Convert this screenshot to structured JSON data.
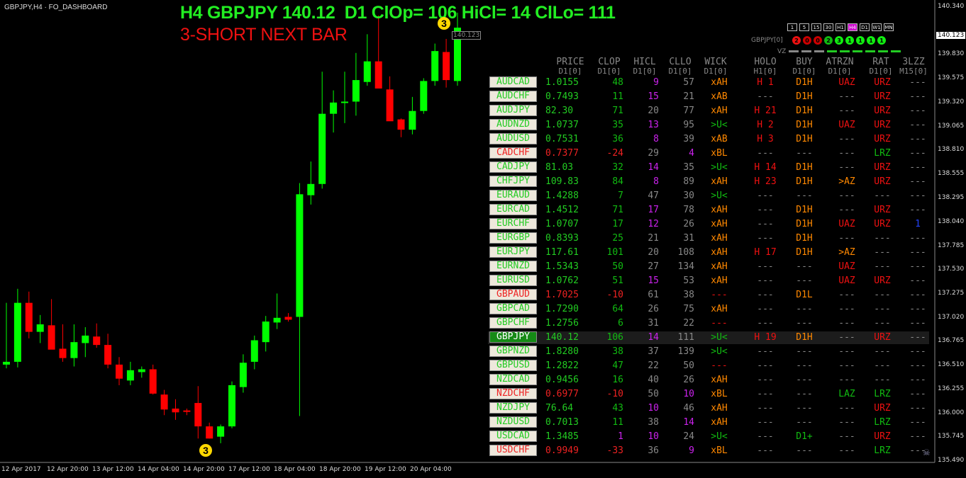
{
  "window": {
    "title": "GBPJPY,H4 · FO_DASHBOARD",
    "indicator_name": "FO_DASHBOARD"
  },
  "headline": {
    "line1": "H4 GBPJPY 140.12  D1 ClOp= 106 HiCl= 14 ClLo= 111",
    "line2": "3-SHORT NEXT BAR"
  },
  "timeframes": [
    "1",
    "5",
    "15",
    "30",
    "H1",
    "H4",
    "D1",
    "W1",
    "MN"
  ],
  "selected_timeframe": "H4",
  "signal_symbol": "GBPJPY[0]",
  "signal_dots": [
    {
      "label": "2",
      "color": "#ee1111"
    },
    {
      "label": "0",
      "color": "#cc0000"
    },
    {
      "label": "0",
      "color": "#cc0000"
    },
    {
      "label": "2",
      "color": "#11bb11"
    },
    {
      "label": "3",
      "color": "#11ee11"
    },
    {
      "label": "1",
      "color": "#11ee11"
    },
    {
      "label": "1",
      "color": "#11ee11"
    },
    {
      "label": "1",
      "color": "#11ee11"
    },
    {
      "label": "1",
      "color": "#11ee11"
    }
  ],
  "vz_label": "VZ",
  "vz_bars": [
    "#888888",
    "#888888",
    "#888888",
    "#22cc22",
    "#22cc22",
    "#22cc22",
    "#22cc22",
    "#22cc22",
    "#22cc22"
  ],
  "columns": [
    {
      "name": "PRICE",
      "sub": "D1[0]"
    },
    {
      "name": "CLOP",
      "sub": "D1[0]"
    },
    {
      "name": "HICL",
      "sub": "D1[0]"
    },
    {
      "name": "CLLO",
      "sub": "D1[0]"
    },
    {
      "name": "WICK",
      "sub": "D1[0]"
    },
    {
      "name": "HOLO",
      "sub": "H1[0]"
    },
    {
      "name": "BUY",
      "sub": "D1[0]"
    },
    {
      "name": "ATRZN",
      "sub": "D1[0]"
    },
    {
      "name": "RAT",
      "sub": "D1[0]"
    },
    {
      "name": "3LZZ",
      "sub": "M15[0]"
    }
  ],
  "rows": [
    {
      "sym": "AUDCAD",
      "price": "1.0155",
      "clop": "48",
      "hicl": "9",
      "cllo": "57",
      "wick": "xAH",
      "holo": "H 1",
      "buy": "D1H",
      "atr": "UAZ",
      "rat": "URZ",
      "zz": "---",
      "neg": false,
      "hp": true,
      "cp": false
    },
    {
      "sym": "AUDCHF",
      "price": "0.7493",
      "clop": "11",
      "hicl": "15",
      "cllo": "21",
      "wick": "xAB",
      "holo": "---",
      "buy": "D1H",
      "atr": "---",
      "rat": "URZ",
      "zz": "---",
      "neg": false,
      "hp": true,
      "cp": false
    },
    {
      "sym": "AUDJPY",
      "price": "82.30",
      "clop": "71",
      "hicl": "20",
      "cllo": "77",
      "wick": "xAH",
      "holo": "H 21",
      "buy": "D1H",
      "atr": "---",
      "rat": "URZ",
      "zz": "---",
      "neg": false,
      "hp": false,
      "cp": false
    },
    {
      "sym": "AUDNZD",
      "price": "1.0737",
      "clop": "35",
      "hicl": "13",
      "cllo": "95",
      "wick": ">U<",
      "holo": "H 2",
      "buy": "D1H",
      "atr": "UAZ",
      "rat": "URZ",
      "zz": "---",
      "neg": false,
      "hp": true,
      "cp": false
    },
    {
      "sym": "AUDUSD",
      "price": "0.7531",
      "clop": "36",
      "hicl": "8",
      "cllo": "39",
      "wick": "xAB",
      "holo": "H 3",
      "buy": "D1H",
      "atr": "---",
      "rat": "URZ",
      "zz": "---",
      "neg": false,
      "hp": true,
      "cp": false
    },
    {
      "sym": "CADCHF",
      "price": "0.7377",
      "clop": "-24",
      "hicl": "29",
      "cllo": "4",
      "wick": "xBL",
      "holo": "---",
      "buy": "---",
      "atr": "---",
      "rat": "LRZ",
      "zz": "---",
      "neg": true,
      "hp": false,
      "cp": true
    },
    {
      "sym": "CADJPY",
      "price": "81.03",
      "clop": "32",
      "hicl": "14",
      "cllo": "35",
      "wick": ">U<",
      "holo": "H 14",
      "buy": "D1H",
      "atr": "---",
      "rat": "URZ",
      "zz": "---",
      "neg": false,
      "hp": true,
      "cp": false
    },
    {
      "sym": "CHFJPY",
      "price": "109.83",
      "clop": "84",
      "hicl": "8",
      "cllo": "89",
      "wick": "xAH",
      "holo": "H 23",
      "buy": "D1H",
      "atr": ">AZ",
      "rat": "URZ",
      "zz": "---",
      "neg": false,
      "hp": true,
      "cp": false
    },
    {
      "sym": "EURAUD",
      "price": "1.4288",
      "clop": "7",
      "hicl": "47",
      "cllo": "30",
      "wick": ">U<",
      "holo": "---",
      "buy": "---",
      "atr": "---",
      "rat": "---",
      "zz": "---",
      "neg": false,
      "hp": false,
      "cp": false
    },
    {
      "sym": "EURCAD",
      "price": "1.4512",
      "clop": "71",
      "hicl": "17",
      "cllo": "78",
      "wick": "xAH",
      "holo": "---",
      "buy": "D1H",
      "atr": "---",
      "rat": "URZ",
      "zz": "---",
      "neg": false,
      "hp": true,
      "cp": false
    },
    {
      "sym": "EURCHF",
      "price": "1.0707",
      "clop": "17",
      "hicl": "12",
      "cllo": "26",
      "wick": "xAH",
      "holo": "---",
      "buy": "D1H",
      "atr": "UAZ",
      "rat": "URZ",
      "zz": "1",
      "neg": false,
      "hp": true,
      "cp": false
    },
    {
      "sym": "EURGBP",
      "price": "0.8393",
      "clop": "25",
      "hicl": "21",
      "cllo": "31",
      "wick": "xAH",
      "holo": "---",
      "buy": "D1H",
      "atr": "---",
      "rat": "---",
      "zz": "---",
      "neg": false,
      "hp": false,
      "cp": false
    },
    {
      "sym": "EURJPY",
      "price": "117.61",
      "clop": "101",
      "hicl": "20",
      "cllo": "108",
      "wick": "xAH",
      "holo": "H 17",
      "buy": "D1H",
      "atr": ">AZ",
      "rat": "---",
      "zz": "---",
      "neg": false,
      "hp": false,
      "cp": false
    },
    {
      "sym": "EURNZD",
      "price": "1.5343",
      "clop": "50",
      "hicl": "27",
      "cllo": "134",
      "wick": "xAH",
      "holo": "---",
      "buy": "---",
      "atr": "UAZ",
      "rat": "---",
      "zz": "---",
      "neg": false,
      "hp": false,
      "cp": false
    },
    {
      "sym": "EURUSD",
      "price": "1.0762",
      "clop": "51",
      "hicl": "15",
      "cllo": "53",
      "wick": "xAH",
      "holo": "---",
      "buy": "---",
      "atr": "UAZ",
      "rat": "URZ",
      "zz": "---",
      "neg": false,
      "hp": true,
      "cp": false
    },
    {
      "sym": "GBPAUD",
      "price": "1.7025",
      "clop": "-10",
      "hicl": "61",
      "cllo": "38",
      "wick": "---",
      "holo": "---",
      "buy": "D1L",
      "atr": "---",
      "rat": "---",
      "zz": "---",
      "neg": true,
      "hp": false,
      "cp": false
    },
    {
      "sym": "GBPCAD",
      "price": "1.7290",
      "clop": "64",
      "hicl": "26",
      "cllo": "75",
      "wick": "xAH",
      "holo": "---",
      "buy": "---",
      "atr": "---",
      "rat": "---",
      "zz": "---",
      "neg": false,
      "hp": false,
      "cp": false
    },
    {
      "sym": "GBPCHF",
      "price": "1.2756",
      "clop": "6",
      "hicl": "31",
      "cllo": "22",
      "wick": "---",
      "holo": "---",
      "buy": "---",
      "atr": "---",
      "rat": "---",
      "zz": "---",
      "neg": false,
      "hp": false,
      "cp": false
    },
    {
      "sym": "GBPJPY",
      "price": "140.12",
      "clop": "106",
      "hicl": "14",
      "cllo": "111",
      "wick": ">U<",
      "holo": "H 19",
      "buy": "D1H",
      "atr": "---",
      "rat": "URZ",
      "zz": "---",
      "neg": false,
      "hp": true,
      "cp": false,
      "sel": true
    },
    {
      "sym": "GBPNZD",
      "price": "1.8280",
      "clop": "38",
      "hicl": "37",
      "cllo": "139",
      "wick": ">U<",
      "holo": "---",
      "buy": "---",
      "atr": "---",
      "rat": "---",
      "zz": "---",
      "neg": false,
      "hp": false,
      "cp": false
    },
    {
      "sym": "GBPUSD",
      "price": "1.2822",
      "clop": "47",
      "hicl": "22",
      "cllo": "50",
      "wick": "---",
      "holo": "---",
      "buy": "---",
      "atr": "---",
      "rat": "---",
      "zz": "---",
      "neg": false,
      "hp": false,
      "cp": false
    },
    {
      "sym": "NZDCAD",
      "price": "0.9456",
      "clop": "16",
      "hicl": "40",
      "cllo": "26",
      "wick": "xAH",
      "holo": "---",
      "buy": "---",
      "atr": "---",
      "rat": "---",
      "zz": "---",
      "neg": false,
      "hp": false,
      "cp": false
    },
    {
      "sym": "NZDCHF",
      "price": "0.6977",
      "clop": "-10",
      "hicl": "50",
      "cllo": "10",
      "wick": "xBL",
      "holo": "---",
      "buy": "---",
      "atr": "LAZ",
      "rat": "LRZ",
      "zz": "---",
      "neg": true,
      "hp": false,
      "cp": true
    },
    {
      "sym": "NZDJPY",
      "price": "76.64",
      "clop": "43",
      "hicl": "10",
      "cllo": "46",
      "wick": "xAH",
      "holo": "---",
      "buy": "---",
      "atr": "---",
      "rat": "URZ",
      "zz": "---",
      "neg": false,
      "hp": true,
      "cp": false
    },
    {
      "sym": "NZDUSD",
      "price": "0.7013",
      "clop": "11",
      "hicl": "38",
      "cllo": "14",
      "wick": "xAH",
      "holo": "---",
      "buy": "---",
      "atr": "---",
      "rat": "LRZ",
      "zz": "---",
      "neg": false,
      "hp": false,
      "cp": true
    },
    {
      "sym": "USDCAD",
      "price": "1.3485",
      "clop": "1",
      "hicl": "10",
      "cllo": "24",
      "wick": ">U<",
      "holo": "---",
      "buy": "D1+",
      "atr": "---",
      "rat": "URZ",
      "zz": "---",
      "neg": false,
      "hp": true,
      "cp": false,
      "cp1": true
    },
    {
      "sym": "USDCHF",
      "price": "0.9949",
      "clop": "-33",
      "hicl": "36",
      "cllo": "9",
      "wick": "xBL",
      "holo": "---",
      "buy": "---",
      "atr": "---",
      "rat": "LRZ",
      "zz": "---",
      "neg": true,
      "hp": false,
      "cp": true
    }
  ],
  "price_axis": [
    "140.340",
    "140.123",
    "139.830",
    "139.575",
    "139.320",
    "139.065",
    "138.810",
    "138.555",
    "138.295",
    "138.040",
    "137.785",
    "137.530",
    "137.275",
    "137.020",
    "136.765",
    "136.510",
    "136.255",
    "136.000",
    "135.745",
    "135.490"
  ],
  "current_price_label": "140.123",
  "time_axis": [
    "12 Apr 2017",
    "12 Apr 20:00",
    "13 Apr 12:00",
    "14 Apr 04:00",
    "14 Apr 20:00",
    "17 Apr 12:00",
    "18 Apr 04:00",
    "18 Apr 20:00",
    "19 Apr 12:00",
    "20 Apr 04:00"
  ],
  "signal_markers": [
    "3",
    "3"
  ],
  "colors": {
    "bull": "#00ff00",
    "bear": "#ff0000",
    "price": "#22cc22",
    "neg": "#ee2222",
    "magenta": "#cc22ee",
    "orange": "#ff8800",
    "redtxt": "#ee1111",
    "green": "#11bb11",
    "grey": "#888888"
  },
  "chart_data": {
    "type": "candlestick",
    "symbol": "GBPJPY",
    "timeframe": "H4",
    "ylim": [
      135.49,
      140.34
    ],
    "candles": [
      {
        "o": 136.52,
        "h": 137.18,
        "l": 136.48,
        "c": 136.55
      },
      {
        "o": 136.55,
        "h": 137.33,
        "l": 136.49,
        "c": 137.18
      },
      {
        "o": 137.18,
        "h": 137.3,
        "l": 136.8,
        "c": 136.87
      },
      {
        "o": 136.87,
        "h": 137.05,
        "l": 136.75,
        "c": 136.95
      },
      {
        "o": 136.94,
        "h": 137.22,
        "l": 136.7,
        "c": 136.68
      },
      {
        "o": 136.69,
        "h": 136.95,
        "l": 136.55,
        "c": 136.59
      },
      {
        "o": 136.59,
        "h": 136.95,
        "l": 136.5,
        "c": 136.76
      },
      {
        "o": 136.75,
        "h": 136.92,
        "l": 136.6,
        "c": 136.83
      },
      {
        "o": 136.82,
        "h": 136.96,
        "l": 136.7,
        "c": 136.73
      },
      {
        "o": 136.73,
        "h": 136.85,
        "l": 136.48,
        "c": 136.52
      },
      {
        "o": 136.52,
        "h": 136.6,
        "l": 136.3,
        "c": 136.37
      },
      {
        "o": 136.35,
        "h": 136.55,
        "l": 136.3,
        "c": 136.46
      },
      {
        "o": 136.44,
        "h": 136.5,
        "l": 136.38,
        "c": 136.47
      },
      {
        "o": 136.47,
        "h": 136.52,
        "l": 136.2,
        "c": 136.21
      },
      {
        "o": 136.2,
        "h": 136.25,
        "l": 135.98,
        "c": 136.04
      },
      {
        "o": 136.05,
        "h": 136.15,
        "l": 135.93,
        "c": 136.01
      },
      {
        "o": 136.03,
        "h": 136.05,
        "l": 135.98,
        "c": 136.02
      },
      {
        "o": 136.11,
        "h": 136.29,
        "l": 135.73,
        "c": 135.86
      },
      {
        "o": 135.86,
        "h": 135.9,
        "l": 135.73,
        "c": 135.73
      },
      {
        "o": 135.75,
        "h": 135.88,
        "l": 135.68,
        "c": 135.86
      },
      {
        "o": 135.86,
        "h": 136.34,
        "l": 135.84,
        "c": 136.3
      },
      {
        "o": 136.28,
        "h": 136.63,
        "l": 136.22,
        "c": 136.54
      },
      {
        "o": 136.55,
        "h": 136.83,
        "l": 136.47,
        "c": 136.78
      },
      {
        "o": 136.76,
        "h": 137.04,
        "l": 136.66,
        "c": 136.98
      },
      {
        "o": 136.97,
        "h": 137.28,
        "l": 136.9,
        "c": 137.02
      },
      {
        "o": 137.03,
        "h": 137.07,
        "l": 136.98,
        "c": 137.0
      },
      {
        "o": 137.03,
        "h": 138.46,
        "l": 135.97,
        "c": 138.34
      },
      {
        "o": 138.33,
        "h": 138.69,
        "l": 138.23,
        "c": 138.45
      },
      {
        "o": 138.45,
        "h": 139.65,
        "l": 138.4,
        "c": 139.2
      },
      {
        "o": 139.2,
        "h": 139.45,
        "l": 139.0,
        "c": 139.32
      },
      {
        "o": 139.33,
        "h": 139.65,
        "l": 139.1,
        "c": 139.33
      },
      {
        "o": 139.33,
        "h": 139.85,
        "l": 139.18,
        "c": 139.56
      },
      {
        "o": 139.54,
        "h": 140.05,
        "l": 139.5,
        "c": 139.76
      },
      {
        "o": 139.76,
        "h": 140.25,
        "l": 139.7,
        "c": 139.47
      },
      {
        "o": 139.46,
        "h": 139.6,
        "l": 139.15,
        "c": 139.12
      },
      {
        "o": 139.14,
        "h": 139.15,
        "l": 138.95,
        "c": 139.03
      },
      {
        "o": 139.03,
        "h": 139.38,
        "l": 138.98,
        "c": 139.23
      },
      {
        "o": 139.23,
        "h": 139.58,
        "l": 139.2,
        "c": 139.55
      },
      {
        "o": 139.55,
        "h": 139.95,
        "l": 139.5,
        "c": 139.87
      },
      {
        "o": 139.86,
        "h": 140.0,
        "l": 139.48,
        "c": 139.56
      },
      {
        "o": 139.55,
        "h": 140.28,
        "l": 139.5,
        "c": 140.12
      }
    ]
  }
}
